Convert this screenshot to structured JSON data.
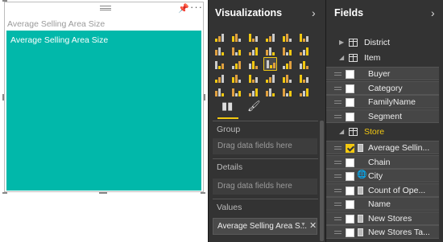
{
  "visual": {
    "title": "Average Selling Area Size",
    "card_label": "Average Selling Area Size",
    "color": "#01b8aa"
  },
  "visualizations": {
    "title": "Visualizations",
    "sections": {
      "group": {
        "label": "Group",
        "placeholder": "Drag data fields here"
      },
      "details": {
        "label": "Details",
        "placeholder": "Drag data fields here"
      },
      "values": {
        "label": "Values",
        "field": "Average Selling Area S..."
      }
    },
    "tabs": [
      "fields-tab",
      "format-tab"
    ]
  },
  "fields": {
    "title": "Fields",
    "items": [
      {
        "label": "District",
        "kind": "table",
        "expanded": false
      },
      {
        "label": "Item",
        "kind": "table",
        "expanded": true
      },
      {
        "label": "Buyer",
        "kind": "field",
        "checked": false
      },
      {
        "label": "Category",
        "kind": "field",
        "checked": false
      },
      {
        "label": "FamilyName",
        "kind": "field",
        "checked": false
      },
      {
        "label": "Segment",
        "kind": "field",
        "checked": false
      },
      {
        "label": "Store",
        "kind": "table",
        "expanded": true,
        "accent": "#f2c811"
      },
      {
        "label": "Average Sellin...",
        "kind": "measure",
        "checked": true
      },
      {
        "label": "Chain",
        "kind": "field",
        "checked": false
      },
      {
        "label": "City",
        "kind": "geo",
        "checked": false
      },
      {
        "label": "Count of Ope...",
        "kind": "measure",
        "checked": false
      },
      {
        "label": "Name",
        "kind": "field",
        "checked": false
      },
      {
        "label": "New Stores",
        "kind": "measure",
        "checked": false
      },
      {
        "label": "New Stores Ta...",
        "kind": "measure",
        "checked": false
      }
    ]
  }
}
